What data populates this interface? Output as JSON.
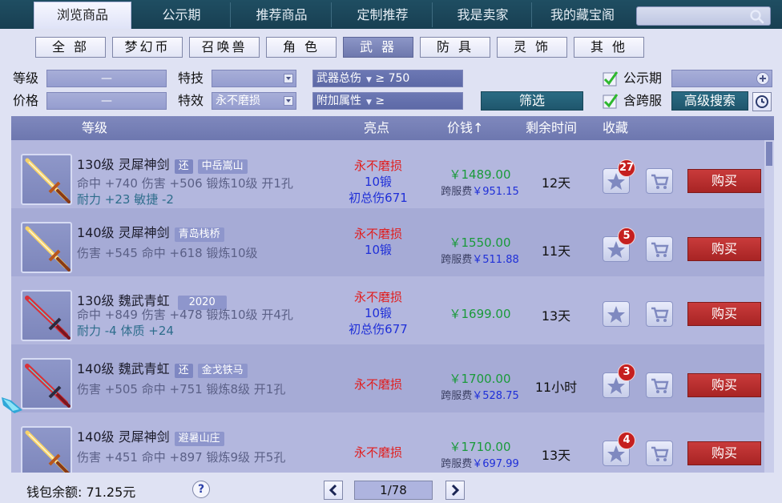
{
  "tabs": [
    {
      "label": "浏览商品",
      "active": true
    },
    {
      "label": "公示期",
      "active": false
    },
    {
      "label": "推荐商品",
      "active": false
    },
    {
      "label": "定制推荐",
      "active": false
    },
    {
      "label": "我是卖家",
      "active": false
    },
    {
      "label": "我的藏宝阁",
      "active": false
    }
  ],
  "categories": [
    {
      "label": "全 部",
      "active": false
    },
    {
      "label": "梦幻币",
      "active": false
    },
    {
      "label": "召唤兽",
      "active": false
    },
    {
      "label": "角 色",
      "active": false
    },
    {
      "label": "武 器",
      "active": true
    },
    {
      "label": "防 具",
      "active": false
    },
    {
      "label": "灵 饰",
      "active": false
    },
    {
      "label": "其 他",
      "active": false
    }
  ],
  "filters": {
    "level_label": "等级",
    "level_value": "—",
    "price_label": "价格",
    "price_value": "—",
    "skill_label": "特技",
    "skill_value": "",
    "effect_label": "特效",
    "effect_value": "永不磨损",
    "total_damage_label": "武器总伤",
    "total_damage_op": "≥",
    "total_damage_value": "750",
    "attr_label": "附加属性",
    "attr_op": "≥",
    "attr_value": "",
    "filter_button": "筛选",
    "publicity_label": "公示期",
    "cross_server_label": "含跨服",
    "advanced_search": "高级搜索"
  },
  "table": {
    "headers": [
      "等级",
      "亮点",
      "价钱↑",
      "剩余时间",
      "收藏"
    ],
    "rows": [
      {
        "name": "130级 灵犀神剑",
        "tags": [
          "还",
          "中岳嵩山"
        ],
        "stats1": "命中 +740 伤害 +506 锻炼10级 开1孔",
        "stats2": "耐力 +23 敏捷 -2",
        "highlights": [
          "永不磨损",
          "10锻",
          "初总伤671"
        ],
        "price": "￥1489.00",
        "fee_label": "跨服费",
        "fee_value": "￥951.15",
        "time": "12天",
        "fav_count": "27",
        "buy_label": "购买",
        "weapon": "gold-sword"
      },
      {
        "name": "140级 灵犀神剑",
        "tags": [
          "青岛栈桥"
        ],
        "stats1": "伤害 +545 命中 +618 锻炼10级",
        "stats2": "",
        "highlights": [
          "永不磨损",
          "10锻"
        ],
        "price": "￥1550.00",
        "fee_label": "跨服费",
        "fee_value": "￥511.88",
        "time": "11天",
        "fav_count": "5",
        "buy_label": "购买",
        "weapon": "gold-sword"
      },
      {
        "name": "130级 魏武青虹",
        "tags": [
          "2020"
        ],
        "stats1": "命中 +849 伤害 +478 锻炼10级 开4孔",
        "stats2": "耐力 -4 体质 +24",
        "highlights": [
          "永不磨损",
          "10锻",
          "初总伤677"
        ],
        "price": "￥1699.00",
        "fee_label": "",
        "fee_value": "",
        "time": "13天",
        "fav_count": "",
        "buy_label": "购买",
        "weapon": "red-sword"
      },
      {
        "name": "140级 魏武青虹",
        "tags": [
          "还",
          "金戈铁马"
        ],
        "stats1": "伤害 +505 命中 +751 锻炼8级 开1孔",
        "stats2": "",
        "highlights": [
          "永不磨损"
        ],
        "price": "￥1700.00",
        "fee_label": "跨服费",
        "fee_value": "￥528.75",
        "time": "11小时",
        "fav_count": "3",
        "buy_label": "购买",
        "weapon": "red-sword"
      },
      {
        "name": "140级 灵犀神剑",
        "tags": [
          "避暑山庄"
        ],
        "stats1": "伤害 +451 命中 +897 锻炼9级 开5孔",
        "stats2": "",
        "highlights": [
          "永不磨损"
        ],
        "price": "￥1710.00",
        "fee_label": "跨服费",
        "fee_value": "￥697.99",
        "time": "13天",
        "fav_count": "4",
        "buy_label": "购买",
        "weapon": "gold-sword"
      }
    ]
  },
  "footer": {
    "wallet": "钱包余额: 71.25元",
    "help": "?",
    "page": "1/78"
  }
}
